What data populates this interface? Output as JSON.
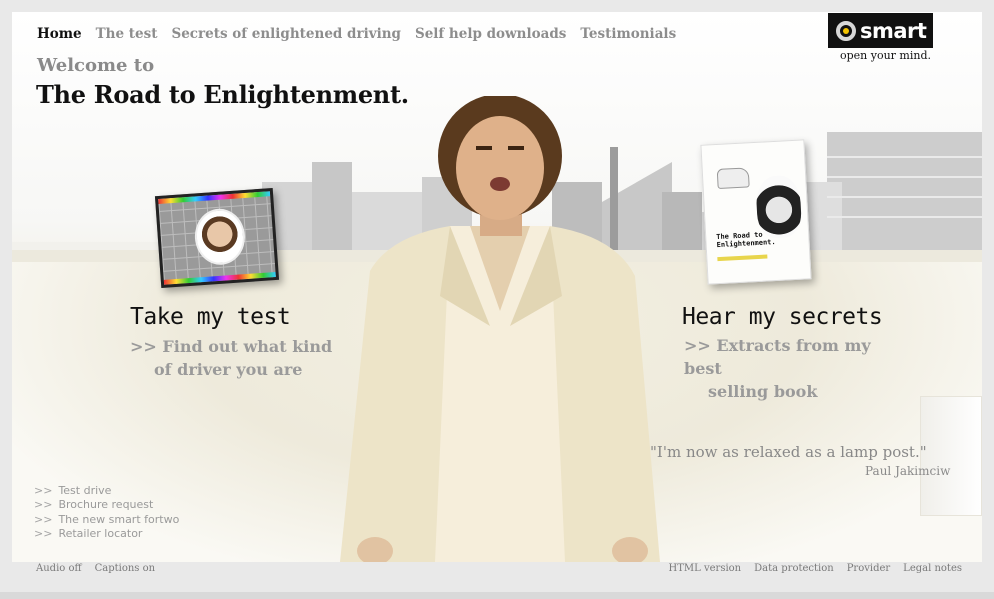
{
  "nav": {
    "items": [
      {
        "label": "Home",
        "active": true
      },
      {
        "label": "The test",
        "active": false
      },
      {
        "label": "Secrets of enlightened driving",
        "active": false
      },
      {
        "label": "Self help downloads",
        "active": false
      },
      {
        "label": "Testimonials",
        "active": false
      }
    ]
  },
  "header": {
    "welcome": "Welcome to",
    "headline": "The Road to Enlightenment."
  },
  "logo": {
    "text": "smart",
    "tagline": "open your mind."
  },
  "promos": {
    "test": {
      "title": "Take my test",
      "line1": ">> Find out what kind",
      "line2": "of driver you are"
    },
    "secrets": {
      "title": "Hear my secrets",
      "line1": ">> Extracts from my best",
      "line2": "selling book"
    }
  },
  "book": {
    "title": "The Road to Enlightenment."
  },
  "quote": {
    "text": "\"I'm now as relaxed as a lamp post.\"",
    "author": "Paul Jakimciw"
  },
  "quick_links": [
    {
      "arrow": ">>",
      "label": "Test drive"
    },
    {
      "arrow": ">>",
      "label": "Brochure request"
    },
    {
      "arrow": ">>",
      "label": "The new smart fortwo"
    },
    {
      "arrow": ">>",
      "label": "Retailer locator"
    }
  ],
  "footer": {
    "left": [
      "Audio off",
      "Captions on"
    ],
    "right": [
      "HTML version",
      "Data protection",
      "Provider",
      "Legal notes"
    ]
  },
  "colors": {
    "accent_yellow": "#f3c300",
    "nav_inactive": "#8d8d8d",
    "text_dark": "#111111",
    "text_muted": "#9a9a9a"
  }
}
